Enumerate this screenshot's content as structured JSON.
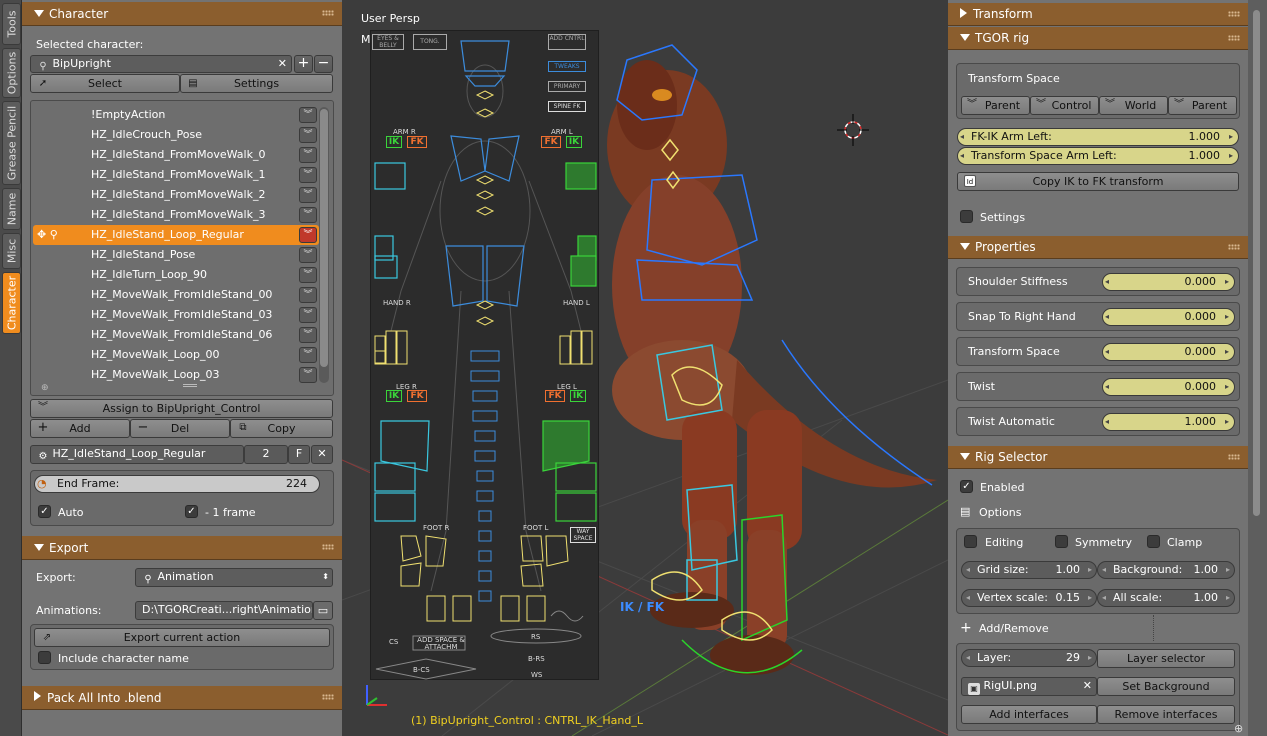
{
  "tabs": [
    "Tools",
    "Options",
    "Grease Pencil",
    "Name",
    "Misc",
    "Character"
  ],
  "character_panel": {
    "title": "Character",
    "selected_label": "Selected character:",
    "selected_value": "BipUpright",
    "select_btn": "Select",
    "settings_btn": "Settings",
    "actions": [
      "!EmptyAction",
      "HZ_IdleCrouch_Pose",
      "HZ_IdleStand_FromMoveWalk_0",
      "HZ_IdleStand_FromMoveWalk_1",
      "HZ_IdleStand_FromMoveWalk_2",
      "HZ_IdleStand_FromMoveWalk_3",
      "HZ_IdleStand_Loop_Regular",
      "HZ_IdleStand_Pose",
      "HZ_IdleTurn_Loop_90",
      "HZ_MoveWalk_FromIdleStand_00",
      "HZ_MoveWalk_FromIdleStand_03",
      "HZ_MoveWalk_FromIdleStand_06",
      "HZ_MoveWalk_Loop_00",
      "HZ_MoveWalk_Loop_03"
    ],
    "selected_index": 6,
    "assign_btn": "Assign to BipUpright_Control",
    "add_btn": "Add",
    "del_btn": "Del",
    "copy_btn": "Copy",
    "action_name": "HZ_IdleStand_Loop_Regular",
    "action_users": "2",
    "action_fake": "F",
    "end_frame_label": "End Frame:",
    "end_frame_value": "224",
    "auto_label": "Auto",
    "minus_one_label": "- 1 frame"
  },
  "export_panel": {
    "title": "Export",
    "export_label": "Export:",
    "export_value": "Animation",
    "animations_label": "Animations:",
    "animations_value": "D:\\TGORCreati...right\\Animation\\",
    "export_current_btn": "Export current action",
    "include_name_label": "Include character name"
  },
  "pack_panel": {
    "title": "Pack All Into .blend"
  },
  "viewport": {
    "view_label": "User Persp",
    "status": "(1) BipUpright_Control : CNTRL_IK_Hand_L",
    "picker_labels": {
      "eyes_belly": "EYES & BELLY",
      "tong": "TONG.",
      "add_cntrl": "ADD CNTRL",
      "tweaks": "TWEAKS",
      "primary": "PRIMARY",
      "spine_fk": "SPINE FK",
      "arm_r": "ARM R",
      "arm_l": "ARM L",
      "hand_r": "HAND R",
      "hand_l": "HAND L",
      "leg_r": "LEG R",
      "leg_l": "LEG L",
      "foot_r": "FOOT R",
      "foot_l": "FOOT L",
      "wayspace": "WAY SPACE",
      "cs": "CS",
      "add_space": "ADD SPACE & ATTACHM",
      "rs": "RS",
      "b_cs": "B-CS",
      "b_rs": "B-RS",
      "ws": "WS",
      "ik": "IK",
      "fk": "FK",
      "ik_fk_floating": "IK / FK"
    }
  },
  "transform_panel": {
    "title": "Transform"
  },
  "tgor_panel": {
    "title": "TGOR rig",
    "space_title": "Transform Space",
    "space_buttons": [
      "Parent",
      "Control",
      "World",
      "Parent"
    ],
    "fkik_label": "FK-IK Arm Left:",
    "fkik_value": "1.000",
    "tspace_label": "Transform Space Arm Left:",
    "tspace_value": "1.000",
    "copy_btn": "Copy IK to FK transform",
    "settings_label": "Settings"
  },
  "properties_panel": {
    "title": "Properties",
    "rows": [
      {
        "label": "Shoulder Stiffness",
        "value": "0.000"
      },
      {
        "label": "Snap To Right Hand",
        "value": "0.000"
      },
      {
        "label": "Transform Space",
        "value": "0.000"
      },
      {
        "label": "Twist",
        "value": "0.000"
      },
      {
        "label": "Twist Automatic",
        "value": "1.000"
      }
    ]
  },
  "rig_selector": {
    "title": "Rig Selector",
    "enabled_label": "Enabled",
    "options_label": "Options",
    "editing_label": "Editing",
    "symmetry_label": "Symmetry",
    "clamp_label": "Clamp",
    "grid_label": "Grid size:",
    "grid_value": "1.00",
    "bg_label": "Background:",
    "bg_value": "1.00",
    "vscale_label": "Vertex scale:",
    "vscale_value": "0.15",
    "ascale_label": "All scale:",
    "ascale_value": "1.00",
    "addremove_label": "Add/Remove",
    "layer_label": "Layer:",
    "layer_value": "29",
    "layer_selector_btn": "Layer selector",
    "image_value": "RigUI.png",
    "set_bg_btn": "Set Background",
    "add_if_btn": "Add interfaces",
    "remove_if_btn": "Remove interfaces"
  }
}
